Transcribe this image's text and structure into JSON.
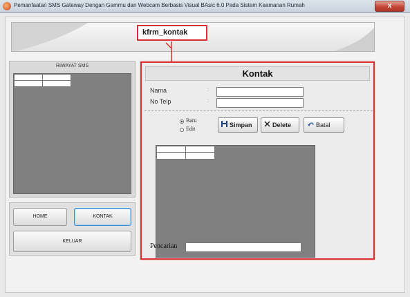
{
  "window": {
    "title": "Pemanfaatan SMS Gateway Dengan Gammu dan Webcam Berbasis Visual BAsic 6.0 Pada Sistem Keamanan Rumah",
    "close_label": "x"
  },
  "annotation": {
    "form_name": "kfrm_kontak"
  },
  "riwayat": {
    "title": "RIWAYAT SMS"
  },
  "nav": {
    "home_label": "HOME",
    "kontak_label": "KONTAK",
    "keluar_label": "KELUAR",
    "active": "KONTAK"
  },
  "kontak": {
    "title": "Kontak",
    "nama_label": "Nama",
    "notelp_label": "No Telp",
    "colon": ":",
    "nama_value": "",
    "notelp_value": "",
    "mode_options": [
      "Baru",
      "Edit"
    ],
    "mode_selected": "Baru",
    "simpan_label": "Simpan",
    "delete_label": "Delete",
    "batal_label": "Batal",
    "pencarian_label": "Pencarian",
    "pencarian_value": ""
  },
  "colors": {
    "highlight_border": "#d63030",
    "grid_background": "#808080",
    "active_button_border": "#3c8dde"
  },
  "icons": {
    "simpan": "floppy-disk-icon",
    "delete": "x-mark-icon",
    "batal": "undo-arrow-icon",
    "app": "app-icon"
  }
}
